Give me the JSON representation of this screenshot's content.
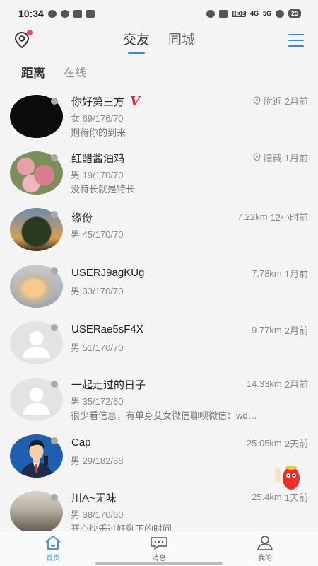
{
  "status_bar": {
    "time": "10:34",
    "network": "HD2",
    "signal_1": "4G",
    "signal_2": "5G",
    "battery": "25"
  },
  "header": {
    "tabs": [
      {
        "label": "交友",
        "active": true
      },
      {
        "label": "同城",
        "active": false
      }
    ],
    "accent_color": "#2d8ae6",
    "notification_dot_color": "#f24c5a"
  },
  "subtabs": [
    {
      "label": "距离",
      "active": true
    },
    {
      "label": "在线",
      "active": false
    }
  ],
  "users": [
    {
      "name": "你好第三方",
      "vip_badge": "V",
      "location": "附近",
      "time": "2月前",
      "info": "女 69/176/70",
      "bio": "期待你的到来",
      "avatar": "black"
    },
    {
      "name": "红醋酱油鸡",
      "location": "隐藏",
      "time": "1月前",
      "info": "男 19/170/70",
      "bio": "没特长就是特长",
      "avatar": "roses"
    },
    {
      "name": "缘份",
      "distance": "7.22km",
      "time": "12小时前",
      "info": "男 45/170/70",
      "avatar": "tree"
    },
    {
      "name": "USERJ9agKUg",
      "distance": "7.78km",
      "time": "1月前",
      "info": "男 33/170/70",
      "avatar": "sky"
    },
    {
      "name": "USERae5sF4X",
      "distance": "9.77km",
      "time": "2月前",
      "info": "男 51/170/70",
      "avatar": "default"
    },
    {
      "name": "一起走过的日子",
      "distance": "14.33km",
      "time": "2月前",
      "info": "男 35/172/60",
      "bio": "很少看信息，有单身艾女微信聊呗微信：wd…",
      "avatar": "default"
    },
    {
      "name": "Cap",
      "distance": "25.05km",
      "time": "2天前",
      "info": "男 29/182/88",
      "avatar": "man"
    },
    {
      "name": "川A~无味",
      "distance": "25.4km",
      "time": "1天前",
      "info": "男 38/170/60",
      "bio": "开心快乐过好剩下的时间",
      "avatar": "street"
    }
  ],
  "bottom_nav": [
    {
      "label": "首页",
      "icon": "home-icon",
      "active": true
    },
    {
      "label": "消息",
      "icon": "chat-icon",
      "active": false
    },
    {
      "label": "我的",
      "icon": "user-icon",
      "active": false
    }
  ]
}
